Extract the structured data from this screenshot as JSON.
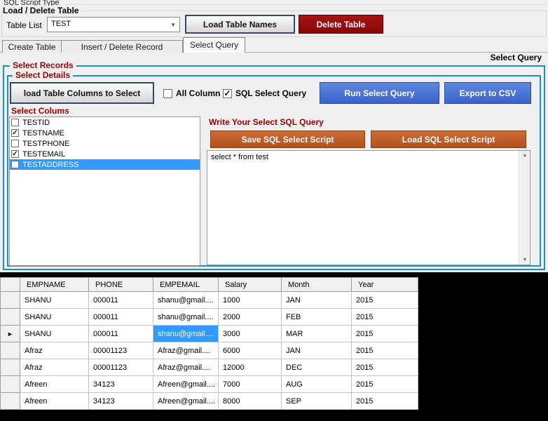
{
  "header": {
    "script_type_label": "SQL Script Type",
    "section_label": "Load / Delete Table",
    "table_list_label": "Table List",
    "table_list_value": "TEST",
    "load_table_names_button": "Load Table Names",
    "delete_table_button": "Delete Table"
  },
  "tabs": {
    "items": [
      {
        "label": "Create Table",
        "active": false
      },
      {
        "label": "Insert / Delete Record",
        "active": false
      },
      {
        "label": "Select Query",
        "active": true
      }
    ],
    "corner_label": "Select Query"
  },
  "select_query_panel": {
    "group_label": "Select Records",
    "details_label": "Select Details",
    "load_columns_button": "load Table Columns to Select",
    "all_column_checkbox": {
      "label": "All Column",
      "checked": false
    },
    "sql_query_checkbox": {
      "label": "SQL Select Query",
      "checked": true
    },
    "run_query_button": "Run Select Query",
    "export_csv_button": "Export to CSV",
    "select_columns_label": "Select Colums",
    "columns": [
      {
        "label": "TESTID",
        "checked": false,
        "selected": false
      },
      {
        "label": "TESTNAME",
        "checked": true,
        "selected": false
      },
      {
        "label": "TESTPHONE",
        "checked": false,
        "selected": false
      },
      {
        "label": "TESTEMAIL",
        "checked": true,
        "selected": false
      },
      {
        "label": "TESTADDRESS",
        "checked": false,
        "selected": true
      }
    ],
    "query_editor": {
      "label": "Write Your Select SQL Query",
      "save_button": "Save SQL Select Script",
      "load_button": "Load SQL Select Script",
      "query_text": "select * from test"
    }
  },
  "results_grid": {
    "columns": [
      "EMPNAME",
      "PHONE",
      "EMPEMAIL",
      "Salary",
      "Month",
      "Year"
    ],
    "rows": [
      [
        "SHANU",
        "000011",
        "shanu@gmail....",
        "1000",
        "JAN",
        "2015"
      ],
      [
        "SHANU",
        "000011",
        "shanu@gmail....",
        "2000",
        "FEB",
        "2015"
      ],
      [
        "SHANU",
        "000011",
        "shanu@gmail....",
        "3000",
        "MAR",
        "2015"
      ],
      [
        "Afraz",
        "00001123",
        "Afraz@gmail....",
        "6000",
        "JAN",
        "2015"
      ],
      [
        "Afraz",
        "00001123",
        "Afraz@gmail....",
        "12000",
        "DEC",
        "2015"
      ],
      [
        "Afreen",
        "34123",
        "Afreen@gmail....",
        "7000",
        "AUG",
        "2015"
      ],
      [
        "Afreen",
        "34123",
        "Afreen@gmail....",
        "8000",
        "SEP",
        "2015"
      ]
    ],
    "current_row_index": 2,
    "selected_cell": {
      "row": 2,
      "col": 2
    }
  },
  "icons": {
    "combo_dropdown": "▼",
    "current_row_arrow": "►",
    "checkmark": "✓",
    "scroll_up_arrow": "▲",
    "scroll_down_arrow": "▼"
  },
  "colors": {
    "group_border": "#1d8fc4",
    "label_maroon": "#990000",
    "blue_button": "#3b62cc",
    "orange_button": "#b2511d",
    "dark_red_button": "#8a0606",
    "selection_blue": "#3399ff",
    "grid_backdrop": "#000000"
  }
}
